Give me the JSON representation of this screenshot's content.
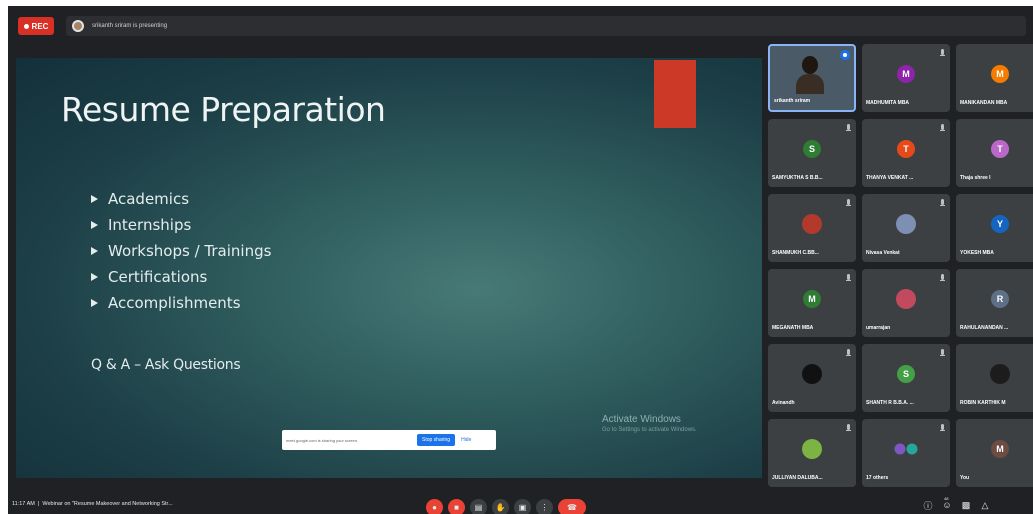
{
  "topbar": {
    "rec_label": "REC",
    "presenting_text": "srikanth sriram is presenting"
  },
  "slide": {
    "title": "Resume Preparation",
    "bullets": [
      "Academics",
      "Internships",
      "Workshops / Trainings",
      "Certifications",
      "Accomplishments"
    ],
    "qa": "Q & A – Ask Questions",
    "activate_title": "Activate Windows",
    "activate_sub": "Go to Settings to activate Windows."
  },
  "share_bar": {
    "text": "meet.google.com is sharing your screen.",
    "stop_label": "Stop sharing",
    "hide_label": "Hide"
  },
  "participants": [
    {
      "name": "srikanth sriram",
      "type": "video"
    },
    {
      "name": "MADHUMITA MBA",
      "initial": "M",
      "color": "#8e24aa"
    },
    {
      "name": "MANIKANDAN MBA",
      "initial": "M",
      "color": "#f57c00"
    },
    {
      "name": "SAMYUKTHA S B.B...",
      "initial": "S",
      "color": "#2e7d32"
    },
    {
      "name": "THANYA VENKAT ...",
      "initial": "T",
      "color": "#e64a19"
    },
    {
      "name": "Thaja shree I",
      "initial": "T",
      "color": "#ba68c8"
    },
    {
      "name": "SHANMUKH C.BB...",
      "type": "photo",
      "color": "#b33a2a"
    },
    {
      "name": "Nivasa Venkat",
      "type": "photo",
      "color": "#7d8fb3"
    },
    {
      "name": "YOKESH MBA",
      "initial": "Y",
      "color": "#1565c0"
    },
    {
      "name": "MEGANATH MBA",
      "initial": "M",
      "color": "#2e7d32"
    },
    {
      "name": "umarrajan",
      "type": "photo",
      "color": "#c24a5e"
    },
    {
      "name": "RAHULANANDAN ...",
      "initial": "R",
      "color": "#5f6f86"
    },
    {
      "name": "Avinandh",
      "type": "photo",
      "color": "#111111"
    },
    {
      "name": "SHANTH R B.B.A. ...",
      "initial": "S",
      "color": "#43a047"
    },
    {
      "name": "ROBIN KARTHIK M",
      "type": "photo",
      "color": "#1c1c1c"
    },
    {
      "name": "JULLIYAN DALUBA...",
      "type": "photo",
      "color": "#7cb342"
    },
    {
      "name": "17 others",
      "type": "others"
    },
    {
      "name": "You",
      "initial": "M",
      "color": "#6d4c41"
    }
  ],
  "bottombar": {
    "time": "11:17 AM",
    "meeting_title": "Webinar on \"Resume Makeover and Networking Str..."
  },
  "icons": {
    "mic": "mic-off-icon",
    "camera": "camera-off-icon",
    "captions": "captions-icon",
    "hand": "raise-hand-icon",
    "present": "present-icon",
    "more": "more-icon",
    "end": "end-call-icon",
    "info": "info-icon",
    "people": "people-icon",
    "chat": "chat-icon",
    "activities": "activities-icon"
  },
  "people_count": "48",
  "colors": {
    "rec": "#d93025",
    "end_call": "#ea4335",
    "stop_share": "#1a73e8",
    "slide_accent": "#cc3a27"
  }
}
